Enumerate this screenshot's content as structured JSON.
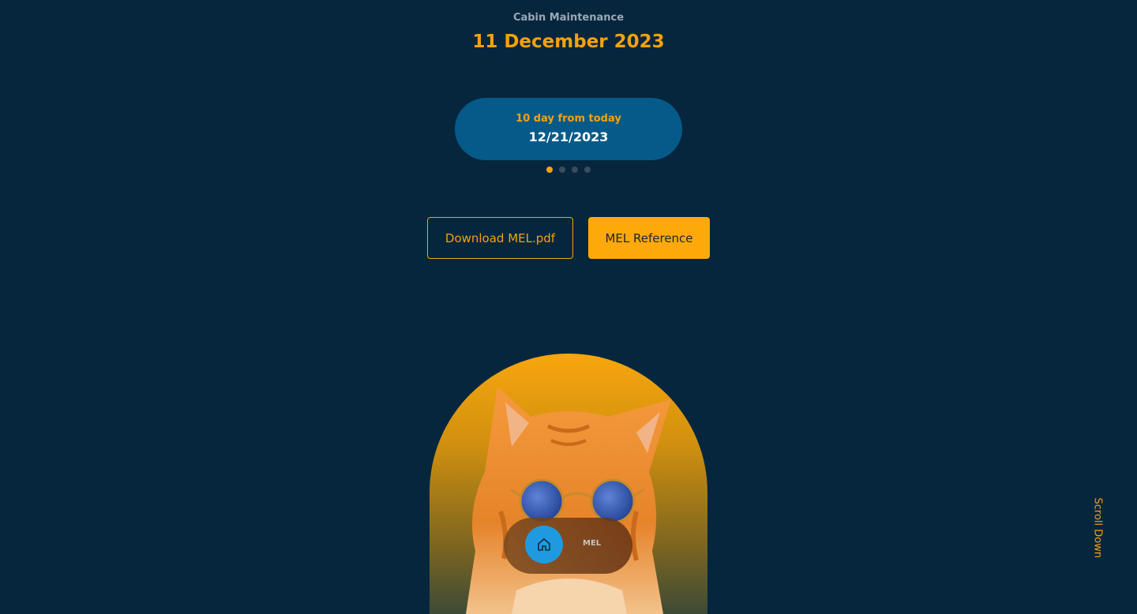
{
  "header": {
    "subtitle": "Cabin Maintenance",
    "date": "11 December 2023"
  },
  "card": {
    "caption": "10 day from today",
    "value": "12/21/2023"
  },
  "carousel": {
    "active_index": 0,
    "count": 4
  },
  "buttons": {
    "download_label": "Download MEL.pdf",
    "reference_label": "MEL Reference"
  },
  "nav": {
    "home_icon": "home-icon",
    "mel_label": "MEL"
  },
  "scroll_hint": "Scroll Down",
  "colors": {
    "background": "#06263d",
    "accent": "#f5a20c",
    "card": "#055a8a",
    "home_button": "#1e9be0"
  }
}
